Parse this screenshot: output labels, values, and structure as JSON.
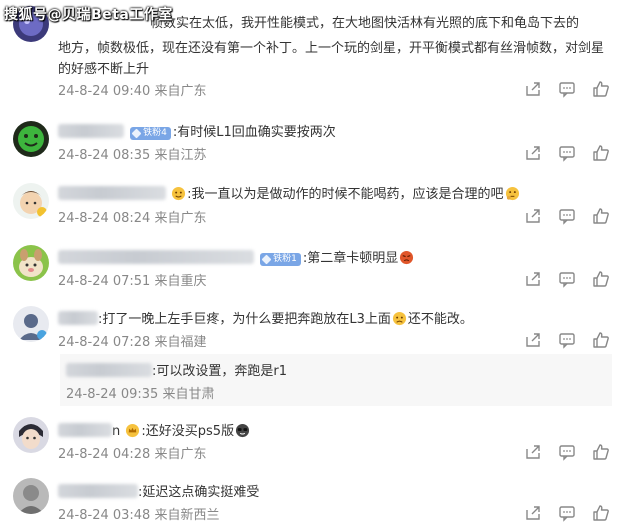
{
  "watermark": "搜狐号@贝瑞Beta工作室",
  "comments": [
    {
      "id": 1,
      "text_lines": [
        "帧数实在太低，我开性能模式，在大地图快活林有光照的底下和龟岛下去的",
        "地方，帧数极低，现在还没有第一个补丁。上一个玩的剑星，开平衡模式都有丝滑帧数，对剑星",
        "的好感不断上升"
      ],
      "date": "24-8-24 09:40",
      "location": "来自广东"
    },
    {
      "id": 2,
      "badge": "铁粉4",
      "text": ":有时候L1回血确实要按两次",
      "date": "24-8-24 08:35",
      "location": "来自江苏"
    },
    {
      "id": 3,
      "text": ":我一直以为是做动作的时候不能喝药，应该是合理的吧",
      "date": "24-8-24 08:24",
      "location": "来自广东"
    },
    {
      "id": 4,
      "badge": "铁粉1",
      "text": ":第二章卡顿明显",
      "date": "24-8-24 07:51",
      "location": "来自重庆"
    },
    {
      "id": 5,
      "text": ":打了一晚上左手巨疼，为什么要把奔跑放在L3上面",
      "text_after": "还不能改。",
      "date": "24-8-24 07:28",
      "location": "来自福建",
      "reply": {
        "text": ":可以改设置，奔跑是r1",
        "date": "24-8-24 09:35",
        "location": "来自甘肃"
      }
    },
    {
      "id": 6,
      "name_tail": "n",
      "text": ":还好没买ps5版",
      "date": "24-8-24 04:28",
      "location": "来自广东"
    },
    {
      "id": 7,
      "text": ":延迟这点确实挺难受",
      "date": "24-8-24 03:48",
      "location": "来自新西兰"
    }
  ],
  "icons": {
    "share": "share-icon",
    "reply": "comment-icon",
    "like": "thumbs-up-icon"
  },
  "colors": {
    "text": "#333333",
    "meta": "#888888",
    "badge": "#7aa6e6",
    "reply_bg": "#f7f7f7"
  }
}
